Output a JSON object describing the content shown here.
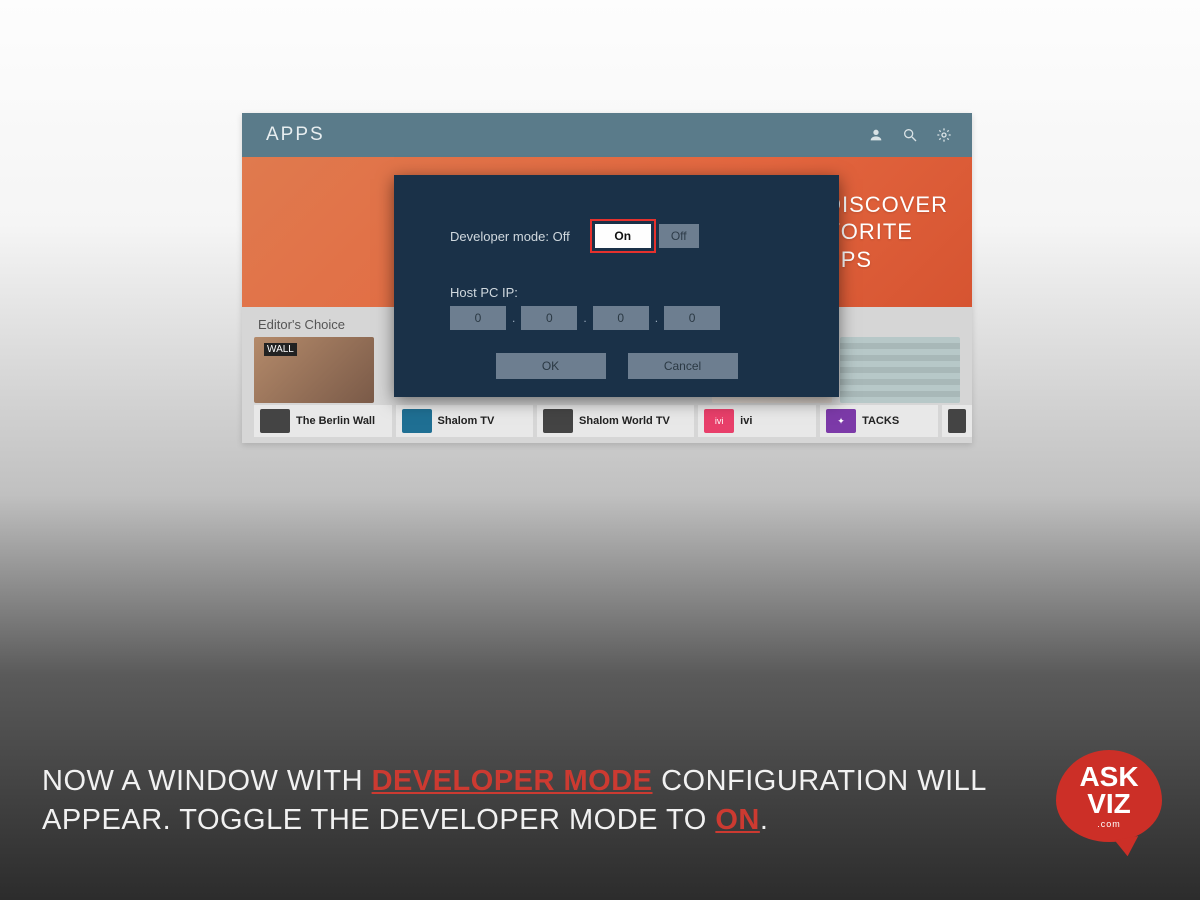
{
  "tv": {
    "title": "APPS",
    "hero_line1": "DISCOVER",
    "hero_line2": "VORITE",
    "hero_line3": "PPS",
    "editors_choice": "Editor's Choice"
  },
  "modal": {
    "dev_label": "Developer mode: Off",
    "on": "On",
    "off": "Off",
    "host_label": "Host PC IP:",
    "ip": [
      "0",
      "0",
      "0",
      "0"
    ],
    "ok": "OK",
    "cancel": "Cancel"
  },
  "apps": [
    "The Berlin Wall",
    "Shalom TV",
    "Shalom World TV",
    "ivi",
    "TACKS"
  ],
  "caption": {
    "p1": "NOW A WINDOW WITH ",
    "hl1": "DEVELOPER MODE",
    "p2": " CONFIGURATION WILL APPEAR. TOGGLE THE DEVELOPER MODE TO ",
    "hl2": "ON",
    "p3": "."
  },
  "logo": {
    "l1": "ASK",
    "l2": "VIZ",
    "l3": ".com"
  }
}
